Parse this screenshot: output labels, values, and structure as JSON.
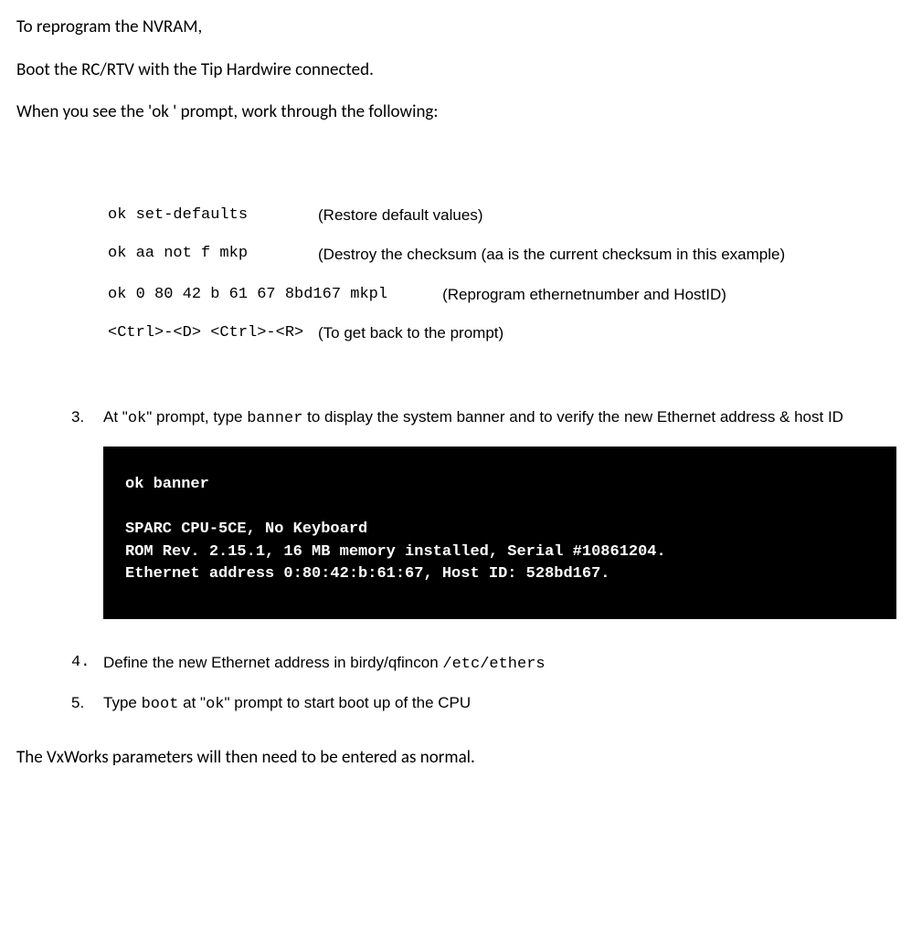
{
  "intro": {
    "p1": "To reprogram the NVRAM,",
    "p2": "Boot the RC/RTV with the Tip Hardwire connected.",
    "p3": "When you see the 'ok ' prompt, work through the following:"
  },
  "commands": {
    "r1_cmd": "ok set-defaults",
    "r1_desc": "(Restore default values)",
    "r2_cmd": "ok aa not f mkp",
    "r2_desc": "(Destroy the checksum (aa is the current checksum in this example)",
    "r3_cmd": "ok 0 80 42 b 61 67 8bd167 mkpl",
    "r3_desc": "(Reprogram ethernetnumber and HostID)",
    "r4_cmd": "<Ctrl>-<D> <Ctrl>-<R>",
    "r4_desc": "(To get back to the prompt)"
  },
  "steps": {
    "s3_num": "3.",
    "s3_a": "At \"",
    "s3_b": "ok",
    "s3_c": "\" prompt, type ",
    "s3_d": "banner",
    "s3_e": " to display the system banner and to verify the new Ethernet address & host ID",
    "s4_num": "4.",
    "s4_a": "Define the new Ethernet address in birdy/qfincon ",
    "s4_b": "/etc/ethers",
    "s5_num": "5.",
    "s5_a": "Type ",
    "s5_b": "boot",
    "s5_c": " at \"",
    "s5_d": "ok",
    "s5_e": "\" prompt to start boot up of the CPU"
  },
  "terminal": {
    "l1": "ok banner",
    "l2": "SPARC CPU-5CE, No Keyboard",
    "l3": "ROM Rev. 2.15.1, 16 MB memory installed, Serial #10861204.",
    "l4": "Ethernet address 0:80:42:b:61:67, Host ID: 528bd167."
  },
  "outro": "The VxWorks parameters will then need to be entered as normal."
}
